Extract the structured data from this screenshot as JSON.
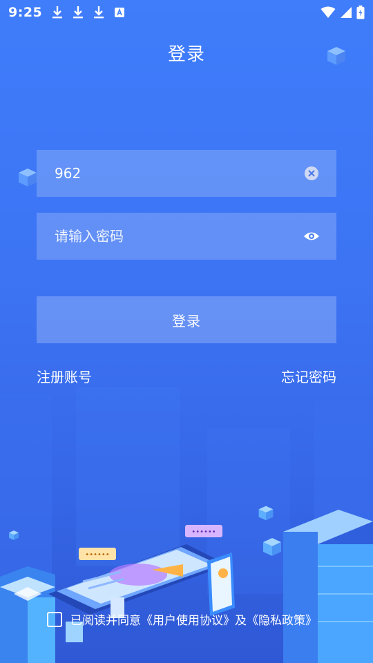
{
  "status_bar": {
    "time": "9:25"
  },
  "header": {
    "title": "登录"
  },
  "login_form": {
    "account_value": "962",
    "password_placeholder": "请输入密码",
    "login_label": "登录"
  },
  "links": {
    "register": "注册账号",
    "forgot": "忘记密码"
  },
  "agreement": {
    "text": "已阅读并同意《用户使用协议》及《隐私政策》"
  },
  "icons": [
    "download-icon",
    "font-icon",
    "wifi-icon",
    "signal-icon",
    "battery-icon",
    "clear-icon",
    "eye-icon",
    "cube-icon"
  ],
  "colors": {
    "background": "#3c73f3",
    "field": "rgba(255,255,255,0.20)"
  }
}
